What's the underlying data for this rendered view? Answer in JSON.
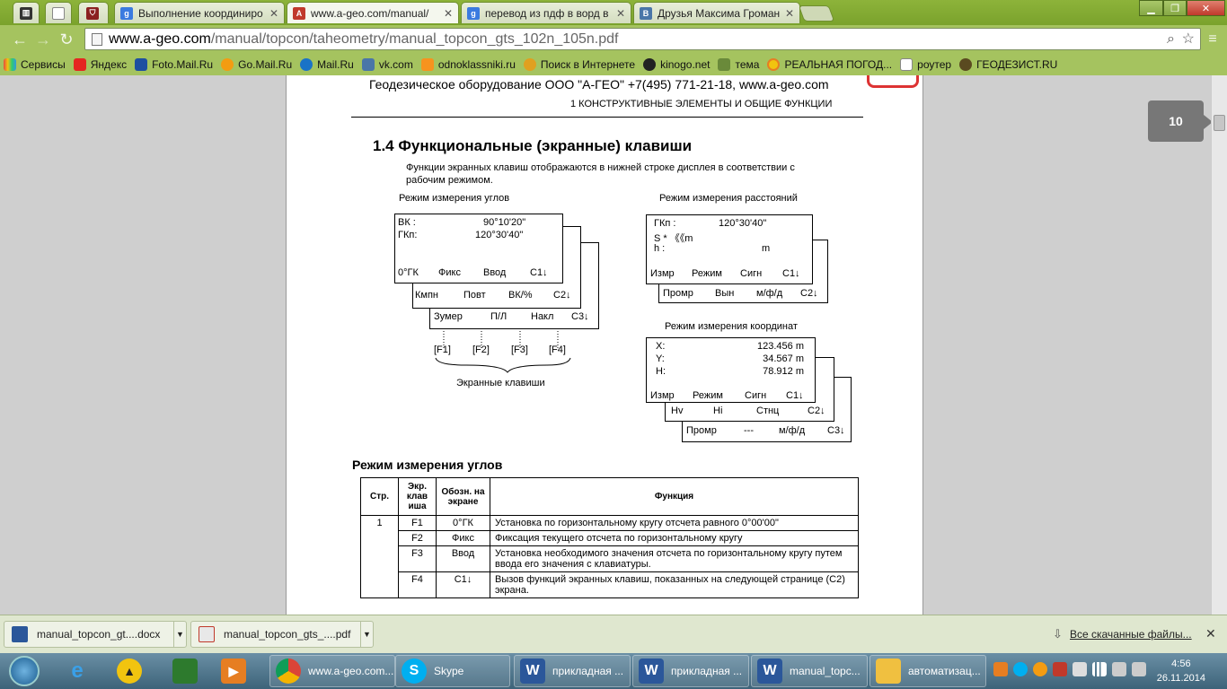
{
  "browser": {
    "tabs": [
      {
        "label": "",
        "icon": "app-icon"
      },
      {
        "label": "",
        "icon": "blank-page-icon"
      },
      {
        "label": "",
        "icon": "shield-icon"
      },
      {
        "label": "Выполнение координиро",
        "icon": "google-icon"
      },
      {
        "label": "www.a-geo.com/manual/",
        "icon": "pdf-icon"
      },
      {
        "label": "перевод из пдф в ворд в",
        "icon": "google-icon"
      },
      {
        "label": "Друзья Максима Громан",
        "icon": "vk-icon"
      }
    ],
    "url_domain": "www.a-geo.com",
    "url_path": "/manual/topcon/taheometry/manual_topcon_gts_102n_105n.pdf",
    "bookmarks": [
      "Сервисы",
      "Яндекс",
      "Foto.Mail.Ru",
      "Go.Mail.Ru",
      "Mail.Ru",
      "vk.com",
      "odnoklassniki.ru",
      "Поиск в Интернете",
      "kinogo.net",
      "тема",
      "РЕАЛЬНАЯ ПОГОД...",
      "роутер",
      "ГЕОДЕЗИСТ.RU"
    ],
    "page_number": "10"
  },
  "pdf": {
    "header_company": "Геодезическое оборудование ООО \"А-ГЕО\" +7(495) 771-21-18, www.a-geo.com",
    "header_section": "1  КОНСТРУКТИВНЫЕ ЭЛЕМЕНТЫ И ОБЩИЕ ФУНКЦИИ",
    "section_title": "1.4  Функциональные (экранные) клавиши",
    "intro_line1": "Функции экранных клавиш отображаются в нижней строке дисплея в соответствии с",
    "intro_line2": "рабочим режимом.",
    "angles": {
      "title": "Режим измерения углов",
      "l1a": "ВК  :",
      "l1b": "90°10'20\"",
      "l2a": "ГКп:",
      "l2b": "120°30'40\"",
      "p1": [
        "0°ГК",
        "Фикс",
        "Ввод",
        "С1↓"
      ],
      "p2": [
        "Кмпн",
        "Повт",
        "ВК/%",
        "С2↓"
      ],
      "p3": [
        "Зумер",
        "П/Л",
        "Накл",
        "С3↓"
      ],
      "fkeys": [
        "[F1]",
        "[F2]",
        "[F3]",
        "[F4]"
      ],
      "softkeys_label": "Экранные клавиши"
    },
    "distance": {
      "title": "Режим измерения расстояний",
      "l1a": "ГКп  :",
      "l1b": "120°30'40\"",
      "l2": "S *  《《m",
      "l3a": "h    :",
      "l3b": "m",
      "p1": [
        "Измр",
        "Режим",
        "Сигн",
        "С1↓"
      ],
      "p2": [
        "Промр",
        "Вын",
        "м/ф/д",
        "С2↓"
      ]
    },
    "coords": {
      "title": "Режим измерения координат",
      "rows": [
        [
          "X:",
          "123.456 m"
        ],
        [
          "Y:",
          "34.567 m"
        ],
        [
          "H:",
          "78.912 m"
        ]
      ],
      "p1": [
        "Измр",
        "Режим",
        "Сигн",
        "С1↓"
      ],
      "p2": [
        "Hv",
        "Hi",
        "Стнц",
        "С2↓"
      ],
      "p3": [
        "Промр",
        "---",
        "м/ф/д",
        "С3↓"
      ]
    },
    "table_title": "Режим измерения углов",
    "table_headers": [
      "Стр.",
      "Экр. клав иша",
      "Обозн. на экране",
      "Функция"
    ],
    "table_rows": [
      [
        "1",
        "F1",
        "0°ГК",
        "Установка по горизонтальному кругу отсчета равного 0°00'00\""
      ],
      [
        "",
        "F2",
        "Фикс",
        "Фиксация текущего отсчета по горизонтальному кругу"
      ],
      [
        "",
        "F3",
        "Ввод",
        "Установка необходимого значения отсчета по горизонтальному кругу путем ввода его значения с клавиатуры."
      ],
      [
        "",
        "F4",
        "С1↓",
        "Вызов функций экранных клавиш, показанных на следующей странице (С2) экрана."
      ]
    ]
  },
  "downloads": {
    "items": [
      "manual_topcon_gt....docx",
      "manual_topcon_gts_....pdf"
    ],
    "show_all": "Все скачанные файлы..."
  },
  "taskbar": {
    "items": [
      "www.a-geo.com...",
      "Skype",
      "прикладная ...",
      "прикладная ...",
      "manual_topc...",
      "автоматизац..."
    ],
    "time": "4:56",
    "date": "26.11.2014"
  }
}
